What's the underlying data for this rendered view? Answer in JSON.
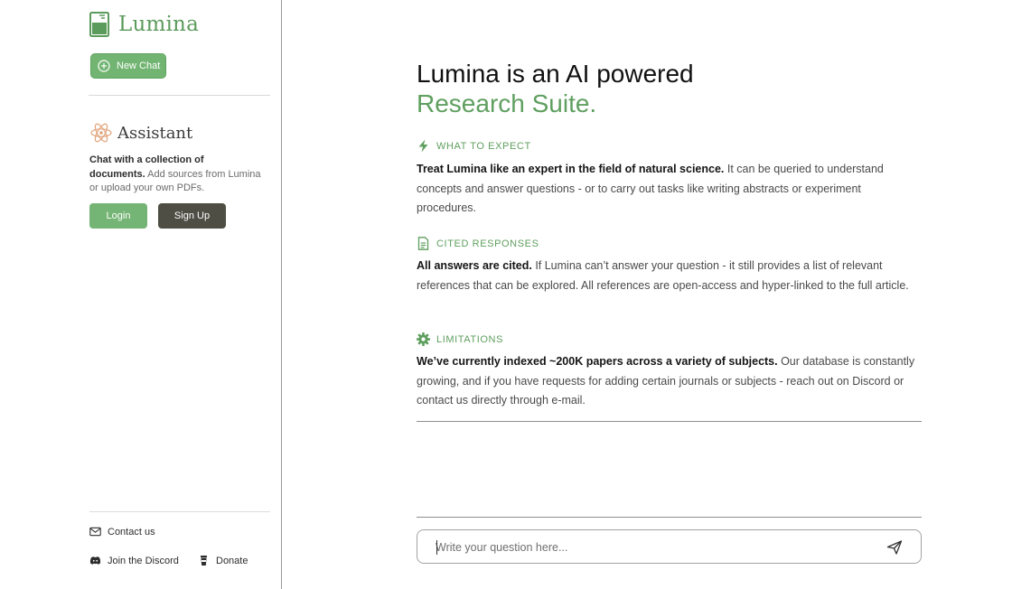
{
  "brand": {
    "name": "Lumina",
    "icon": "beaker-icon"
  },
  "sidebar": {
    "new_chat_label": "New Chat",
    "assistant": {
      "title": "Assistant",
      "desc_bold": "Chat with a collection of documents.",
      "desc_rest": " Add sources from Lumina or upload your own PDFs."
    },
    "login_label": "Login",
    "signup_label": "Sign Up",
    "footer": {
      "contact_label": "Contact us",
      "discord_label": "Join the Discord",
      "donate_label": "Donate"
    }
  },
  "main": {
    "hero_line1": "Lumina is an AI powered",
    "hero_line2": "Research Suite.",
    "sections": [
      {
        "heading": "WHAT TO EXPECT",
        "icon": "lightning-icon",
        "lead": "Treat Lumina like an expert in the field of natural science.",
        "text": " It can be queried to understand concepts and answer questions - or to carry out tasks like writing abstracts or experiment procedures."
      },
      {
        "heading": "CITED RESPONSES",
        "icon": "document-icon",
        "lead": "All answers are cited.",
        "text": " If Lumina can’t answer your question - it still provides a list of relevant references that can be explored. All references are open-access and hyper-linked to the full article."
      },
      {
        "heading": "LIMITATIONS",
        "icon": "gear-icon",
        "lead": "We’ve currently indexed ~200K papers across a variety of subjects.",
        "text": " Our database is constantly growing, and if you have requests for adding certain journals or subjects - reach out on Discord or contact us directly through e-mail."
      }
    ],
    "input": {
      "placeholder": "Write your question here...",
      "value": ""
    }
  },
  "colors": {
    "accent": "#5f9f5f",
    "button_green": "#74b474",
    "button_dark": "#4f4e45"
  }
}
